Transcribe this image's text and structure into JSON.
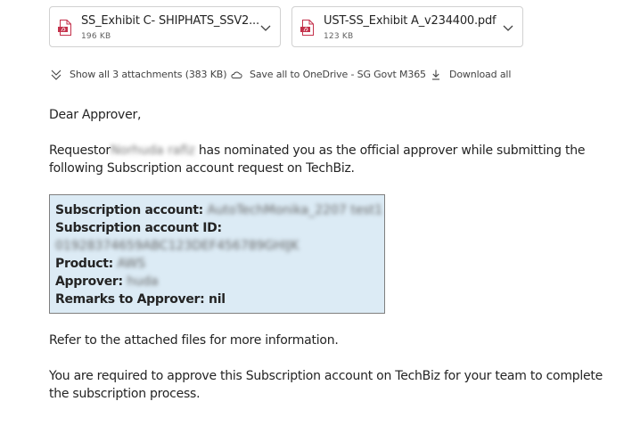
{
  "attachments": [
    {
      "name": "SS_Exhibit C- SHIPHATS_SSV2...",
      "size": "196 KB",
      "icon": "pdf-icon"
    },
    {
      "name": "UST-SS_Exhibit A_v234400.pdf",
      "size": "123 KB",
      "icon": "pdf-icon"
    }
  ],
  "actions": {
    "show_all": "Show all 3 attachments (383 KB)",
    "save_all": "Save all to OneDrive - SG Govt M365",
    "download_all": "Download all"
  },
  "email": {
    "greeting": "Dear Approver,",
    "para1_prefix": "Requestor",
    "requestor_name": "Norhuda rafiz",
    "para1_suffix": "has nominated you as the official approver while submitting the following Subscription account request on TechBiz.",
    "details": {
      "subscription_account_label": "Subscription account:",
      "subscription_account_value": "AutoTechMonika_2207 test1",
      "subscription_account_id_label": "Subscription account ID:",
      "subscription_account_id_value": "01928374659ABC123DEF456789GHIJK",
      "product_label": "Product:",
      "product_value": "AWS",
      "approver_label": "Approver:",
      "approver_value": "huda",
      "remarks_label": "Remarks to Approver:",
      "remarks_value": "nil"
    },
    "para2": "Refer to the attached files for more information.",
    "para3": "You are required to approve this Subscription account on TechBiz for your team to complete the subscription process."
  },
  "colors": {
    "pdf_red": "#c4314b",
    "infobox_bg": "#dcebf5",
    "text": "#242424",
    "muted": "#616161"
  }
}
